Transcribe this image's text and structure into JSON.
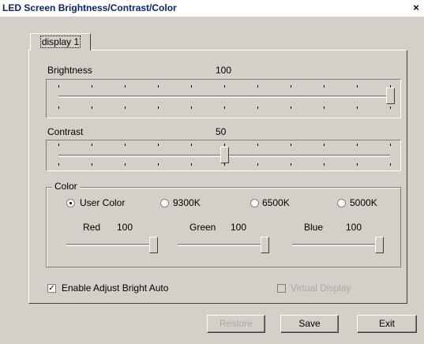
{
  "window": {
    "title": "LED Screen Brightness/Contrast/Color",
    "close_label": "×"
  },
  "tabs": [
    {
      "label": "display 1",
      "selected": true
    }
  ],
  "brightness": {
    "label": "Brightness",
    "value": "100",
    "level": 100,
    "min": 0,
    "max": 100
  },
  "contrast": {
    "label": "Contrast",
    "value": "50",
    "level": 50,
    "min": 0,
    "max": 100
  },
  "color": {
    "group_label": "Color",
    "options": [
      {
        "label": "User Color",
        "selected": true
      },
      {
        "label": "9300K",
        "selected": false
      },
      {
        "label": "6500K",
        "selected": false
      },
      {
        "label": "5000K",
        "selected": false
      }
    ],
    "channels": [
      {
        "label": "Red",
        "value": "100",
        "level": 100
      },
      {
        "label": "Green",
        "value": "100",
        "level": 100
      },
      {
        "label": "Blue",
        "value": "100",
        "level": 100
      }
    ]
  },
  "checkboxes": {
    "auto": {
      "label": "Enable Adjust Bright Auto",
      "checked": true,
      "enabled": true
    },
    "virtual": {
      "label": "Virtual Display",
      "checked": false,
      "enabled": false
    }
  },
  "buttons": {
    "restore": "Restore",
    "save": "Save",
    "exit": "Exit"
  }
}
